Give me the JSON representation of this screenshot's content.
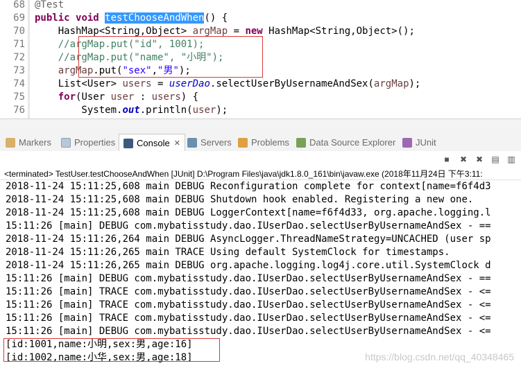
{
  "editor": {
    "line_numbers": [
      "68",
      "69",
      "70",
      "71",
      "72",
      "73",
      "74",
      "75",
      "76"
    ],
    "lines": [
      {
        "parts": [
          {
            "c": "ann",
            "t": "@Test"
          }
        ]
      },
      {
        "parts": [
          {
            "c": "kw",
            "t": "public"
          },
          {
            "c": "",
            "t": " "
          },
          {
            "c": "kw",
            "t": "void"
          },
          {
            "c": "",
            "t": " "
          },
          {
            "c": "sel",
            "t": "testChooseAndWhen"
          },
          {
            "c": "",
            "t": "() {"
          }
        ]
      },
      {
        "parts": [
          {
            "c": "",
            "t": "    HashMap<String,Object> "
          },
          {
            "c": "var",
            "t": "argMap"
          },
          {
            "c": "",
            "t": " = "
          },
          {
            "c": "kw",
            "t": "new"
          },
          {
            "c": "",
            "t": " HashMap<String,Object>();"
          }
        ]
      },
      {
        "parts": [
          {
            "c": "cmt",
            "t": "    //argMap.put(\"id\", 1001);"
          }
        ]
      },
      {
        "parts": [
          {
            "c": "cmt",
            "t": "    //argMap.put(\"name\", \"小明\");"
          }
        ]
      },
      {
        "parts": [
          {
            "c": "var",
            "t": "    argMap"
          },
          {
            "c": "",
            "t": ".put("
          },
          {
            "c": "str",
            "t": "\"sex\""
          },
          {
            "c": "",
            "t": ","
          },
          {
            "c": "str",
            "t": "\"男\""
          },
          {
            "c": "",
            "t": ");"
          }
        ]
      },
      {
        "parts": [
          {
            "c": "",
            "t": "    List<User> "
          },
          {
            "c": "var",
            "t": "users"
          },
          {
            "c": "",
            "t": " = "
          },
          {
            "c": "stat",
            "t": "userDao"
          },
          {
            "c": "",
            "t": ".selectUserByUsernameAndSex("
          },
          {
            "c": "var",
            "t": "argMap"
          },
          {
            "c": "",
            "t": ");"
          }
        ]
      },
      {
        "parts": [
          {
            "c": "",
            "t": "    "
          },
          {
            "c": "kw",
            "t": "for"
          },
          {
            "c": "",
            "t": "(User "
          },
          {
            "c": "var",
            "t": "user"
          },
          {
            "c": "",
            "t": " : "
          },
          {
            "c": "var",
            "t": "users"
          },
          {
            "c": "",
            "t": ") {"
          }
        ]
      },
      {
        "parts": [
          {
            "c": "",
            "t": "        System."
          },
          {
            "c": "stat-b",
            "t": "out"
          },
          {
            "c": "",
            "t": ".println("
          },
          {
            "c": "var",
            "t": "user"
          },
          {
            "c": "",
            "t": ");"
          }
        ]
      }
    ]
  },
  "tabs": [
    {
      "label": "Markers",
      "icon": "markers-icon"
    },
    {
      "label": "Properties",
      "icon": "properties-icon"
    },
    {
      "label": "Console",
      "icon": "console-icon",
      "active": true
    },
    {
      "label": "Servers",
      "icon": "servers-icon"
    },
    {
      "label": "Problems",
      "icon": "problems-icon"
    },
    {
      "label": "Data Source Explorer",
      "icon": "data-source-explorer-icon"
    },
    {
      "label": "JUnit",
      "icon": "junit-icon"
    }
  ],
  "console": {
    "status": "<terminated> TestUser.testChooseAndWhen [JUnit] D:\\Program Files\\java\\jdk1.8.0_161\\bin\\javaw.exe (2018年11月24日 下午3:11:",
    "lines": [
      "2018-11-24 15:11:25,608 main DEBUG Reconfiguration complete for context[name=f6f4d3",
      "2018-11-24 15:11:25,608 main DEBUG Shutdown hook enabled. Registering a new one.",
      "2018-11-24 15:11:25,608 main DEBUG LoggerContext[name=f6f4d33, org.apache.logging.l",
      "15:11:26 [main] DEBUG com.mybatisstudy.dao.IUserDao.selectUserByUsernameAndSex - ==",
      "2018-11-24 15:11:26,264 main DEBUG AsyncLogger.ThreadNameStrategy=UNCACHED (user sp",
      "2018-11-24 15:11:26,265 main TRACE Using default SystemClock for timestamps.",
      "2018-11-24 15:11:26,265 main DEBUG org.apache.logging.log4j.core.util.SystemClock d",
      "15:11:26 [main] DEBUG com.mybatisstudy.dao.IUserDao.selectUserByUsernameAndSex - ==",
      "15:11:26 [main] TRACE com.mybatisstudy.dao.IUserDao.selectUserByUsernameAndSex - <=",
      "15:11:26 [main] TRACE com.mybatisstudy.dao.IUserDao.selectUserByUsernameAndSex - <=",
      "15:11:26 [main] TRACE com.mybatisstudy.dao.IUserDao.selectUserByUsernameAndSex - <=",
      "15:11:26 [main] DEBUG com.mybatisstudy.dao.IUserDao.selectUserByUsernameAndSex - <=",
      "[id:1001,name:小明,sex:男,age:16]",
      "[id:1002,name:小华,sex:男,age:18]"
    ],
    "watermark": "https://blog.csdn.net/qq_40348465"
  },
  "colors": {
    "keyword": "#7f0055",
    "comment": "#3f7f5f",
    "string": "#2a00ff",
    "selection": "#3399ff",
    "highlight_box": "#d9383a"
  }
}
